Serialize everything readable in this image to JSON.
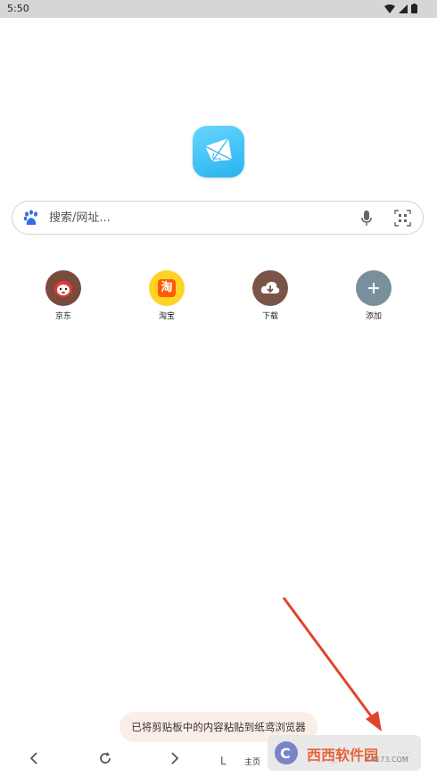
{
  "status_bar": {
    "time": "5:50"
  },
  "search": {
    "placeholder": "搜索/网址..."
  },
  "shortcuts": [
    {
      "label": "京东",
      "color": "#7a4b3c",
      "icon": "jd-dog-icon"
    },
    {
      "label": "淘宝",
      "color": "#ffd226",
      "icon": "taobao-icon"
    },
    {
      "label": "下载",
      "color": "#795548",
      "icon": "download-cloud-icon"
    },
    {
      "label": "添加",
      "color": "#78909c",
      "icon": "plus-icon"
    }
  ],
  "toast": {
    "text": "已将剪贴板中的内容粘贴到纸鸢浏览器"
  },
  "bottom_bar": {
    "home_label": "主页"
  },
  "watermark": {
    "text": "西西软件园",
    "sub": "CR173.COM"
  },
  "colors": {
    "accent": "#29b6f6",
    "arrow": "#e0442c"
  }
}
